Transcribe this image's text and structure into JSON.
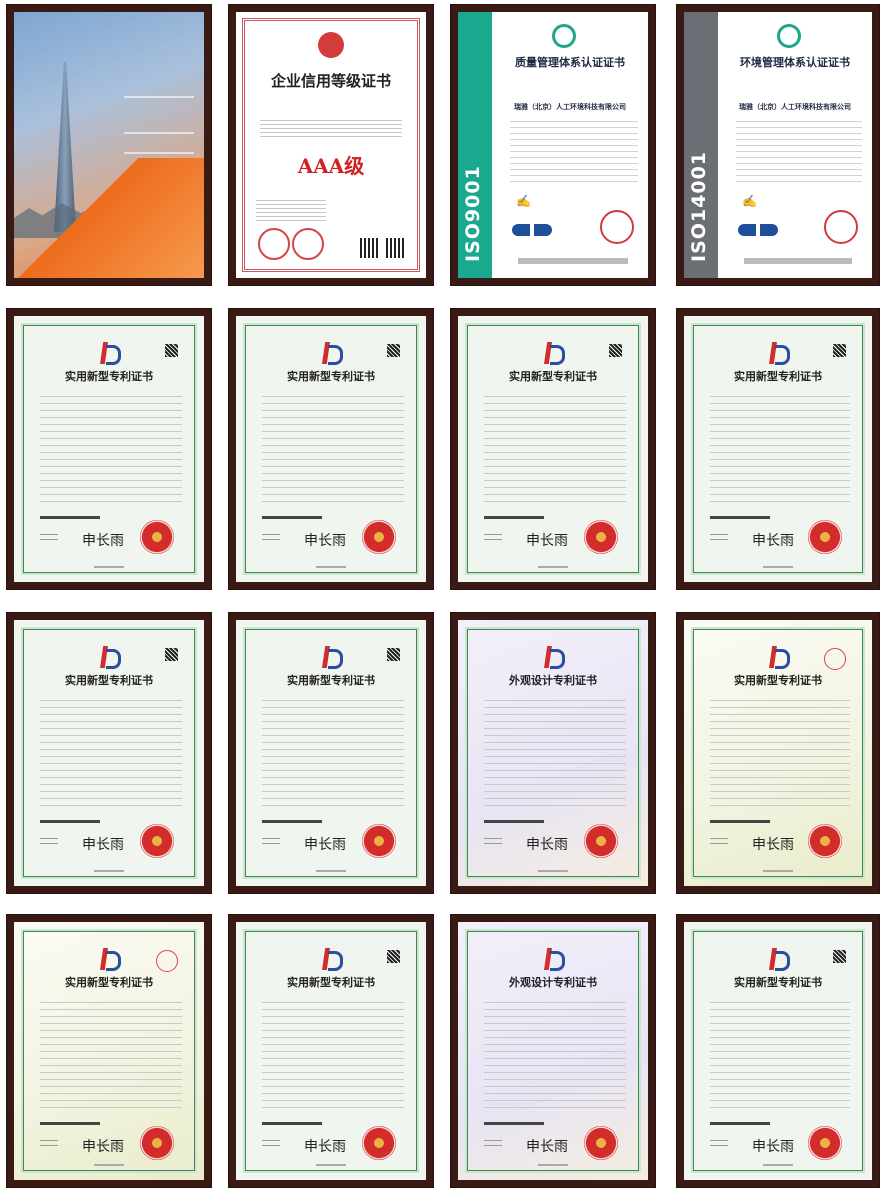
{
  "certificates": {
    "brochure": {
      "header_logo": "",
      "name": ""
    },
    "credit": {
      "title": "企业信用等级证书",
      "grade": "AAA级"
    },
    "iso9001": {
      "code": "ISO9001",
      "title": "质量管理体系认证证书",
      "company": "瑞雅（北京）人工环境科技有限公司",
      "band_color": "#1aa88f"
    },
    "iso14001": {
      "code": "ISO14001",
      "title": "环境管理体系认证证书",
      "company": "瑞雅（北京）人工环境科技有限公司",
      "band_color": "#6b6e74"
    },
    "utility_title": "实用新型专利证书",
    "design_title": "外观设计专利证书",
    "signature": "申长雨"
  },
  "colors": {
    "frame": "#3a1a14",
    "patent_border": "#3a8a56",
    "seal_red": "#d42b2b"
  }
}
